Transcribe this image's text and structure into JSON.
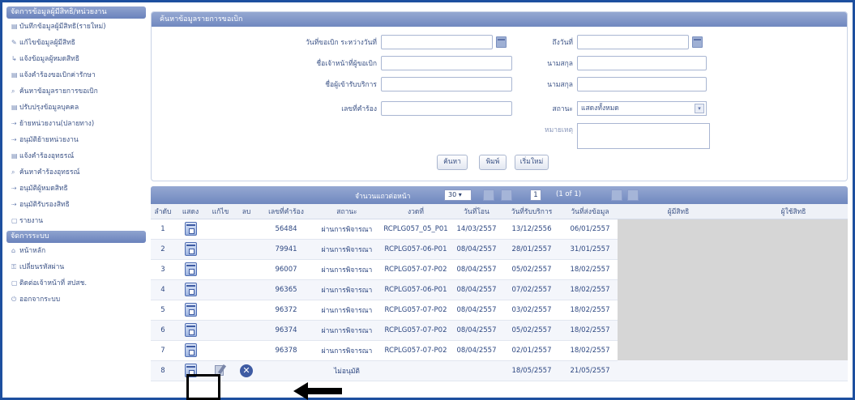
{
  "sidebar": {
    "header": "จัดการข้อมูลผู้มีสิทธิ/หน่วยงาน",
    "items": [
      {
        "icon": "record-icon",
        "glyph": "▤",
        "label": "บันทึกข้อมูลผู้มีสิทธิ(รายใหม่)"
      },
      {
        "icon": "edit-icon",
        "glyph": "✎",
        "label": "แก้ไขข้อมูลผู้มีสิทธิ"
      },
      {
        "icon": "notify-icon",
        "glyph": "↳",
        "label": "แจ้งข้อมูลผู้หมดสิทธิ"
      },
      {
        "icon": "claim-icon",
        "glyph": "▤",
        "label": "แจ้งคำร้องขอเบิกค่ารักษา"
      },
      {
        "icon": "search-icon",
        "glyph": "⌕",
        "label": "ค้นหาข้อมูลรายการขอเบิก"
      },
      {
        "icon": "update-icon",
        "glyph": "▤",
        "label": "ปรับปรุงข้อมูลบุคคล"
      },
      {
        "icon": "transfer-icon",
        "glyph": "⇢",
        "label": "ย้ายหน่วยงาน(ปลายทาง)"
      },
      {
        "icon": "approve-icon",
        "glyph": "⇢",
        "label": "อนุมัติย้ายหน่วยงาน"
      },
      {
        "icon": "appeal-icon",
        "glyph": "▤",
        "label": "แจ้งคำร้องอุทธรณ์"
      },
      {
        "icon": "search-appeal-icon",
        "glyph": "⌕",
        "label": "ค้นหาคำร้องอุทธรณ์"
      },
      {
        "icon": "approve-expire-icon",
        "glyph": "⇢",
        "label": "อนุมัติผู้หมดสิทธิ"
      },
      {
        "icon": "approve-transfer-icon",
        "glyph": "⇢",
        "label": "อนุมัติรับรองสิทธิ"
      },
      {
        "icon": "report-icon",
        "glyph": "▢",
        "label": "รายงาน"
      }
    ],
    "header2": "จัดการระบบ",
    "items2": [
      {
        "icon": "home-icon",
        "glyph": "⌂",
        "label": "หน้าหลัก"
      },
      {
        "icon": "password-icon",
        "glyph": "⚿",
        "label": "เปลี่ยนรหัสผ่าน"
      },
      {
        "icon": "contact-icon",
        "glyph": "▢",
        "label": "ติดต่อเจ้าหน้าที่ สปสช."
      },
      {
        "icon": "logout-icon",
        "glyph": "⏻",
        "label": "ออกจากระบบ"
      }
    ]
  },
  "search": {
    "title": "ค้นหาข้อมูลรายการขอเบิก",
    "date_from_label": "วันที่ขอเบิก ระหว่างวันที่",
    "date_to_label": "ถึงวันที่",
    "officer_label": "ชื่อเจ้าหน้าที่ผู้ขอเบิก",
    "officer_surname_label": "นามสกุล",
    "patient_label": "ชื่อผู้เข้ารับบริการ",
    "patient_surname_label": "นามสกุล",
    "request_no_label": "เลขที่คำร้อง",
    "status_label": "สถานะ",
    "status_value": "แสดงทั้งหมด",
    "note_label": "หมายเหตุ",
    "buttons": {
      "search": "ค้นหา",
      "print": "พิมพ์",
      "reset": "เริ่มใหม่"
    }
  },
  "pager": {
    "rows_label": "จำนวนแถวต่อหน้า",
    "rows_value": "30 ▾",
    "page": "1",
    "of": "(1 of 1)"
  },
  "table": {
    "columns": [
      "ลำดับ",
      "แสดง",
      "แก้ไข",
      "ลบ",
      "เลขที่คำร้อง",
      "สถานะ",
      "งวดที่",
      "วันที่โอน",
      "วันที่รับบริการ",
      "วันที่ส่งข้อมูล",
      "ผู้มีสิทธิ",
      "ผู้ใช้สิทธิ"
    ],
    "rows": [
      {
        "no": "1",
        "req": "56484",
        "status": "ผ่านการพิจารณา",
        "period": "RCPLG057_05_P01",
        "transfer": "14/03/2557",
        "service": "13/12/2556",
        "sent": "06/01/2557"
      },
      {
        "no": "2",
        "req": "79941",
        "status": "ผ่านการพิจารณา",
        "period": "RCPLG057-06-P01",
        "transfer": "08/04/2557",
        "service": "28/01/2557",
        "sent": "31/01/2557"
      },
      {
        "no": "3",
        "req": "96007",
        "status": "ผ่านการพิจารณา",
        "period": "RCPLG057-07-P02",
        "transfer": "08/04/2557",
        "service": "05/02/2557",
        "sent": "18/02/2557"
      },
      {
        "no": "4",
        "req": "96365",
        "status": "ผ่านการพิจารณา",
        "period": "RCPLG057-06-P01",
        "transfer": "08/04/2557",
        "service": "07/02/2557",
        "sent": "18/02/2557"
      },
      {
        "no": "5",
        "req": "96372",
        "status": "ผ่านการพิจารณา",
        "period": "RCPLG057-07-P02",
        "transfer": "08/04/2557",
        "service": "03/02/2557",
        "sent": "18/02/2557"
      },
      {
        "no": "6",
        "req": "96374",
        "status": "ผ่านการพิจารณา",
        "period": "RCPLG057-07-P02",
        "transfer": "08/04/2557",
        "service": "05/02/2557",
        "sent": "18/02/2557"
      },
      {
        "no": "7",
        "req": "96378",
        "status": "ผ่านการพิจารณา",
        "period": "RCPLG057-07-P02",
        "transfer": "08/04/2557",
        "service": "02/01/2557",
        "sent": "18/02/2557"
      },
      {
        "no": "8",
        "req": "",
        "status": "ไม่อนุมัติ",
        "period": "",
        "transfer": "",
        "service": "18/05/2557",
        "sent": "21/05/2557"
      }
    ]
  }
}
